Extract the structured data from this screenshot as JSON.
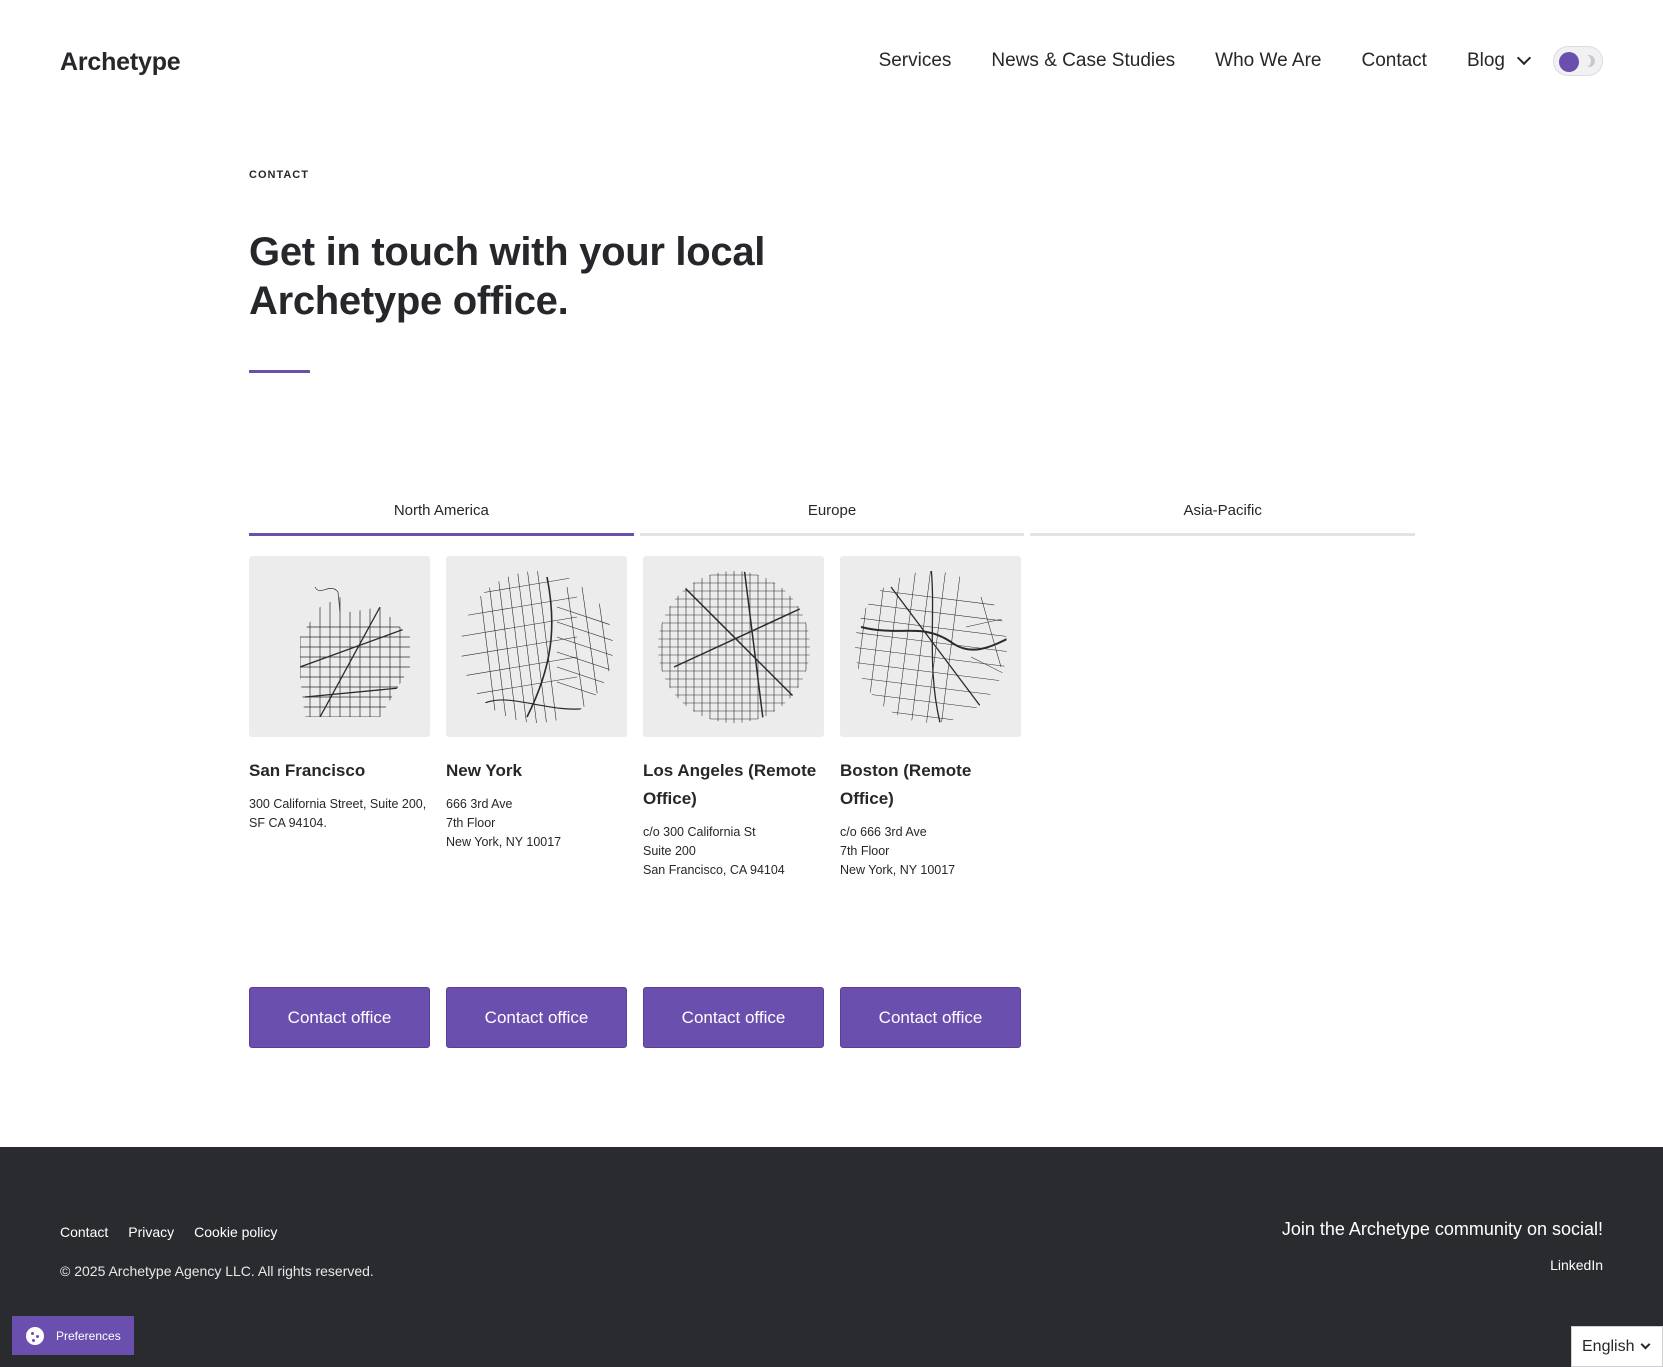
{
  "header": {
    "logo": "Archetype",
    "nav": [
      "Services",
      "News & Case Studies",
      "Who We Are",
      "Contact",
      "Blog"
    ]
  },
  "hero": {
    "eyebrow": "CONTACT",
    "headline": "Get in touch with your local Archetype office."
  },
  "tabs": [
    {
      "label": "North America",
      "active": true
    },
    {
      "label": "Europe",
      "active": false
    },
    {
      "label": "Asia-Pacific",
      "active": false
    }
  ],
  "offices": [
    {
      "name": "San Francisco",
      "address": "300 California Street, Suite 200, SF CA 94104.",
      "button": "Contact office"
    },
    {
      "name": "New York",
      "address": "666 3rd Ave\n7th Floor\nNew York, NY 10017",
      "button": "Contact office"
    },
    {
      "name": "Los Angeles (Remote Office)",
      "address": "c/o 300 California St\nSuite 200\nSan Francisco, CA 94104",
      "button": "Contact office"
    },
    {
      "name": "Boston (Remote Office)",
      "address": "c/o 666 3rd Ave\n7th Floor\nNew York, NY 10017",
      "button": "Contact office"
    }
  ],
  "footer": {
    "links": [
      "Contact",
      "Privacy",
      "Cookie policy"
    ],
    "copyright": "© 2025 Archetype Agency LLC. All rights reserved.",
    "social_title": "Join the Archetype community on social!",
    "social_link": "LinkedIn"
  },
  "widgets": {
    "preferences": "Preferences",
    "language": "English"
  },
  "colors": {
    "accent": "#6b4fae",
    "footer_bg": "#2a2b2f",
    "map_bg": "#ececec"
  }
}
